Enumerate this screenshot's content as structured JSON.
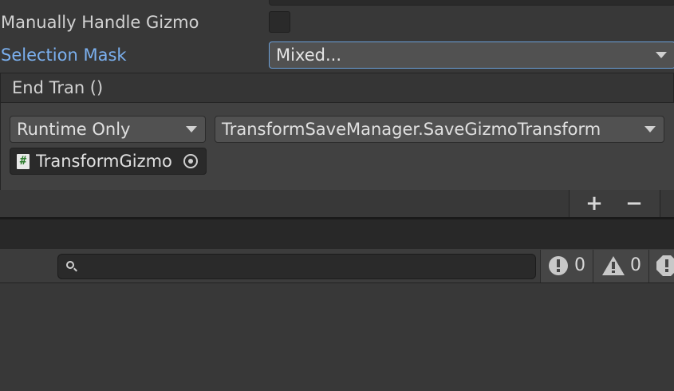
{
  "inspector": {
    "manual_gizmo_label": "Manually Handle Gizmo",
    "manual_gizmo_checked": false,
    "selection_mask_label": "Selection Mask",
    "selection_mask_value": "Mixed...",
    "label_highlight_color": "#7bb0ef"
  },
  "event": {
    "header": "End Tran ()",
    "call_state": "Runtime Only",
    "function": "TransformSaveManager.SaveGizmoTransform",
    "target_object": "TransformGizmo",
    "add_symbol": "+",
    "remove_symbol": "−"
  },
  "console": {
    "search_value": "",
    "log_count": "0",
    "warning_count": "0"
  }
}
